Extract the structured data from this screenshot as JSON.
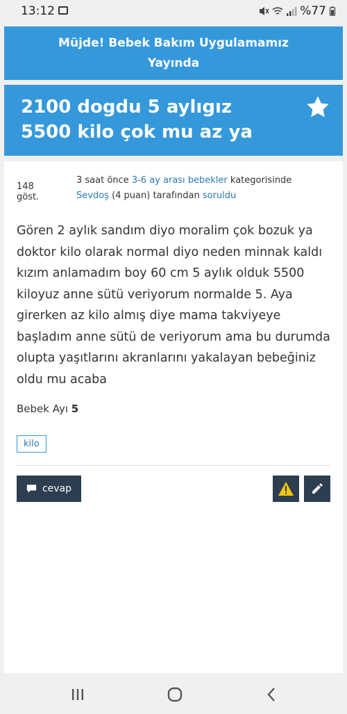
{
  "status": {
    "time": "13:12",
    "battery": "%77"
  },
  "banner": {
    "text": "Müjde! Bebek Bakım Uygulamamız Yayında"
  },
  "question": {
    "title": "2100 dogdu 5 aylıgız 5500 kilo çok mu az ya",
    "views": "148 göst.",
    "time_ago": "3 saat önce",
    "category": "3-6 ay arası bebekler",
    "category_suffix": "kategorisinde",
    "author": "Sevdoş",
    "points": "(4 puan)",
    "by_text": "tarafından",
    "action": "soruldu",
    "body": "Gören 2 aylık sandım diyo moralim çok bozuk ya doktor kilo olarak normal diyo neden minnak kaldı kızım anlamadım boy 60 cm 5 aylık olduk 5500 kiloyuz anne sütü veriyorum normalde 5. Aya girerken az kilo almış diye mama takviyeye başladım anne sütü de veriyorum ama bu durumda olupta yaşıtlarını akranlarını yakalayan bebeğiniz oldu mu acaba",
    "baby_month_label": "Bebek Ayı",
    "baby_month_value": "5",
    "tag": "kilo"
  },
  "actions": {
    "answer_label": "cevap"
  },
  "colors": {
    "primary": "#3498db",
    "dark": "#2c3e50",
    "link": "#2a7ab0",
    "warning": "#f1c40f"
  },
  "icons": [
    "image-icon",
    "mute-icon",
    "wifi-icon",
    "signal-icon",
    "star-icon",
    "comment-icon",
    "warning-icon",
    "edit-icon",
    "recent-apps-icon",
    "home-icon",
    "back-icon"
  ]
}
